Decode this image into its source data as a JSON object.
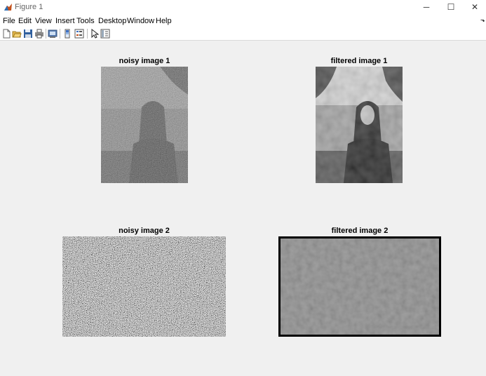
{
  "window": {
    "title": "Figure 1",
    "controls": {
      "minimize": "─",
      "maximize": "☐",
      "close": "✕"
    }
  },
  "menu": {
    "items": [
      "File",
      "Edit",
      "View",
      "Insert",
      "Tools",
      "Desktop",
      "Window",
      "Help"
    ],
    "overflow": "⬎"
  },
  "toolbar": {
    "icons": [
      "new-figure-icon",
      "open-file-icon",
      "save-icon",
      "print-icon",
      "link-plot-icon",
      "insert-colorbar-icon",
      "insert-legend-icon",
      "edit-plot-pointer-icon",
      "open-property-inspector-icon"
    ]
  },
  "figure": {
    "panels": [
      {
        "title": "noisy image 1"
      },
      {
        "title": "filtered image 1"
      },
      {
        "title": "noisy image 2"
      },
      {
        "title": "filtered image 2"
      }
    ]
  },
  "colors": {
    "window_bg": "#f0f0f0",
    "bar_bg": "#ffffff",
    "frame": "#000000"
  }
}
